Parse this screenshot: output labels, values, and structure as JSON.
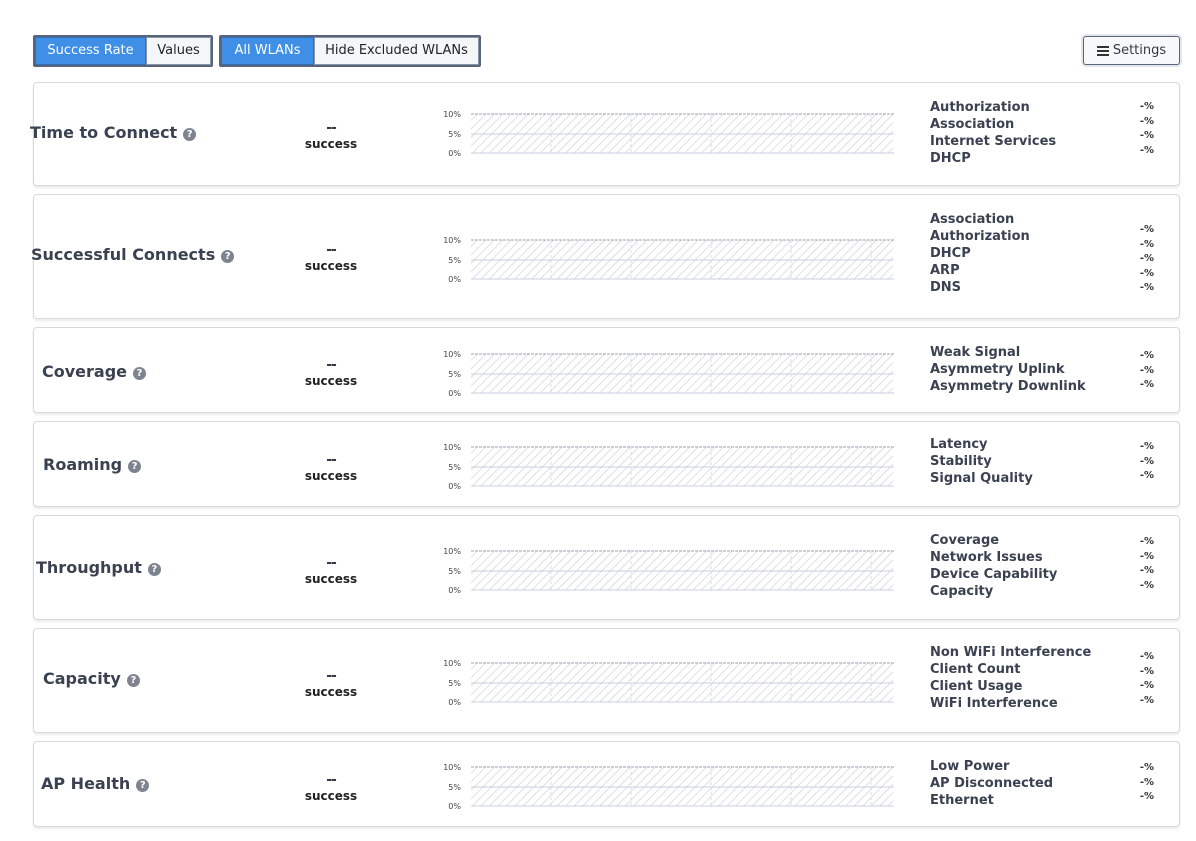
{
  "toolbar": {
    "success_rate": "Success Rate",
    "values": "Values",
    "all_wlans": "All WLANs",
    "hide_excluded": "Hide Excluded WLANs",
    "settings": "Settings"
  },
  "chart_axis": {
    "top": "10%",
    "mid": "5%",
    "bottom": "0%"
  },
  "panels": [
    {
      "title": "Time to Connect",
      "value": "--",
      "value_label": "success",
      "metrics": [
        "Authorization",
        "Association",
        "Internet Services",
        "DHCP"
      ],
      "percents": [
        "-%",
        "-%",
        "-%",
        "-%"
      ]
    },
    {
      "title": "Successful Connects",
      "value": "--",
      "value_label": "success",
      "metrics": [
        "Association",
        "Authorization",
        "DHCP",
        "ARP",
        "DNS"
      ],
      "percents": [
        "-%",
        "-%",
        "-%",
        "-%",
        "-%"
      ]
    },
    {
      "title": "Coverage",
      "value": "--",
      "value_label": "success",
      "metrics": [
        "Weak Signal",
        "Asymmetry Uplink",
        "Asymmetry Downlink"
      ],
      "percents": [
        "-%",
        "-%",
        "-%"
      ]
    },
    {
      "title": "Roaming",
      "value": "--",
      "value_label": "success",
      "metrics": [
        "Latency",
        "Stability",
        "Signal Quality"
      ],
      "percents": [
        "-%",
        "-%",
        "-%"
      ]
    },
    {
      "title": "Throughput",
      "value": "--",
      "value_label": "success",
      "metrics": [
        "Coverage",
        "Network Issues",
        "Device Capability",
        "Capacity"
      ],
      "percents": [
        "-%",
        "-%",
        "-%",
        "-%"
      ]
    },
    {
      "title": "Capacity",
      "value": "--",
      "value_label": "success",
      "metrics": [
        "Non WiFi Interference",
        "Client Count",
        "Client Usage",
        "WiFi Interference"
      ],
      "percents": [
        "-%",
        "-%",
        "-%",
        "-%"
      ]
    },
    {
      "title": "AP Health",
      "value": "--",
      "value_label": "success",
      "metrics": [
        "Low Power",
        "AP Disconnected",
        "Ethernet"
      ],
      "percents": [
        "-%",
        "-%",
        "-%"
      ]
    }
  ]
}
